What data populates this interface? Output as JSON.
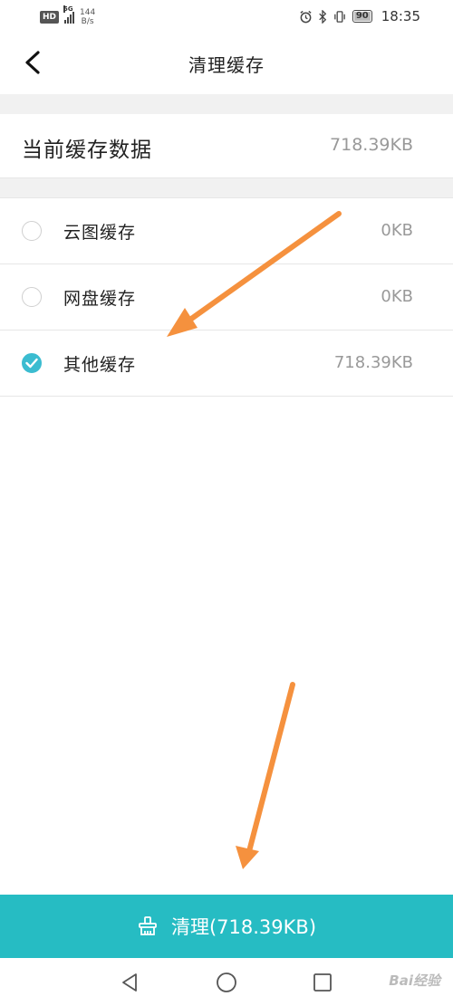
{
  "status_bar": {
    "hd_badge": "HD",
    "network_type": "5G",
    "speed_value": "144",
    "speed_unit": "B/s",
    "battery_level": "90",
    "time": "18:35"
  },
  "header": {
    "title": "清理缓存"
  },
  "summary": {
    "label": "当前缓存数据",
    "value": "718.39KB"
  },
  "cache_items": [
    {
      "label": "云图缓存",
      "size": "0KB",
      "checked": false
    },
    {
      "label": "网盘缓存",
      "size": "0KB",
      "checked": false
    },
    {
      "label": "其他缓存",
      "size": "718.39KB",
      "checked": true
    }
  ],
  "clean_button": {
    "label": "清理(718.39KB)"
  },
  "watermark": "Bai经验",
  "colors": {
    "accent": "#26bcc3",
    "checkbox": "#3bbcd0",
    "annotation_arrow": "#f5913e",
    "secondary_text": "#999999"
  }
}
